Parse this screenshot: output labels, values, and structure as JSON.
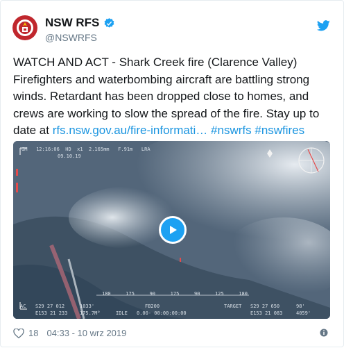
{
  "tweet": {
    "author_name": "NSW RFS",
    "author_handle": "@NSWRFS",
    "text_main": "WATCH AND ACT - Shark Creek fire (Clarence Valley) Firefighters and waterbombing aircraft are battling strong winds. Retardant has been dropped close to homes, and crews are working to slow the spread of the fire. Stay up to date at ",
    "link_text": "rfs.nsw.gov.au/fire-informati…",
    "hashtag_1": "#nswrfs",
    "hashtag_2": "#nswfires",
    "likes": "18",
    "timestamp": "04:33 - 10 wrz 2019"
  },
  "video_overlay": {
    "top_row": [
      "GM",
      "12:16:06",
      "HD",
      "x1",
      "2.165mm",
      "F.91m",
      "LRA"
    ],
    "date": "09.10.19",
    "ac_label": "AC",
    "ac_lat": "S29 27 012",
    "ac_lon": "E153 21 233",
    "ac_alt": "1033'",
    "ac_hdg": "175.7M°",
    "mode": "IDLE",
    "fb": "FB200",
    "zeros": "0.00-  00:00:00:00",
    "target_label": "TARGET",
    "target_lat": "S29 27 650",
    "target_lon": "E153 21 083",
    "target_range": "98'",
    "target_alt": "4059'",
    "scale_ticks": [
      "180",
      "175",
      "90",
      "175",
      "90",
      "125",
      "180"
    ]
  },
  "colors": {
    "link": "#1b95e0",
    "verified": "#1da1f2",
    "twitter_bird": "#1da1f2",
    "avatar_bg": "#c0272d"
  },
  "icons": [
    "twitter-bird-icon",
    "verified-badge-icon",
    "play-icon",
    "heart-icon",
    "info-icon"
  ]
}
